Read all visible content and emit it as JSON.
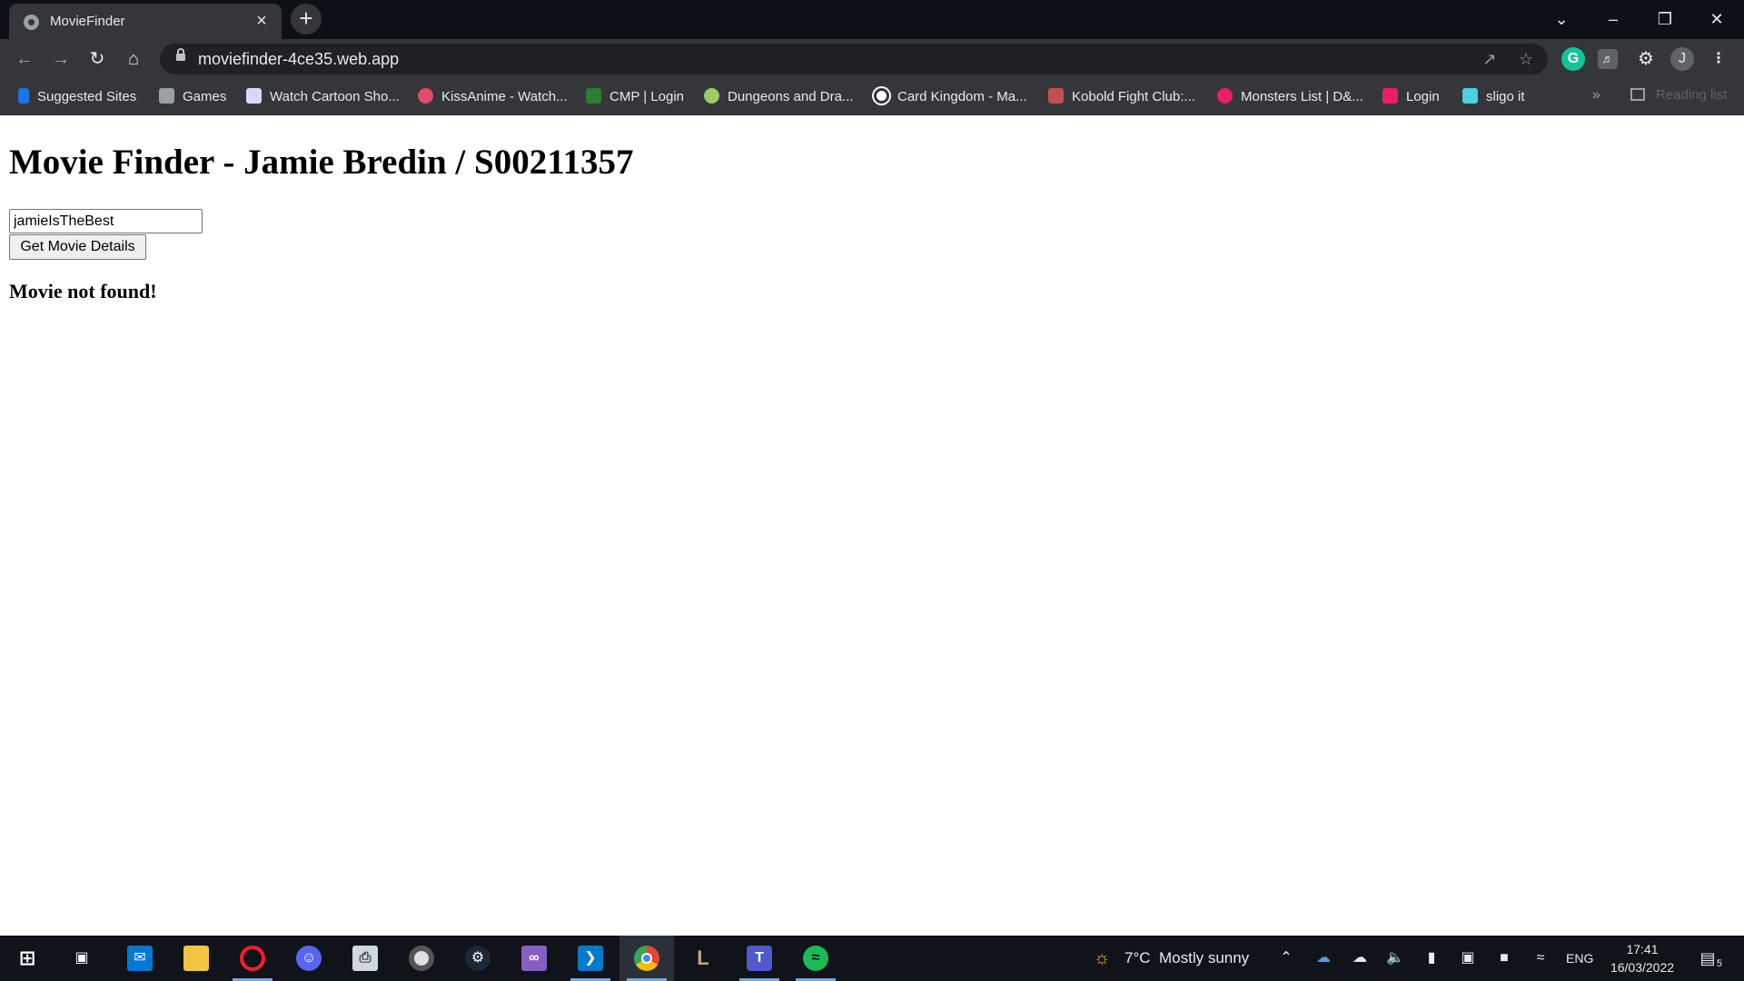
{
  "browser": {
    "tab_title": "MovieFinder",
    "tab_close": "×",
    "new_tab": "+",
    "url": "moviefinder-4ce35.web.app",
    "profile_initial": "J",
    "grammarly_initial": "G"
  },
  "bookmarks": [
    {
      "label": "Suggested Sites",
      "icon": "bing-icon",
      "color": "#1a73e8"
    },
    {
      "label": "Games",
      "icon": "folder-icon",
      "color": "#9aa0a6"
    },
    {
      "label": "Watch Cartoon Sho...",
      "icon": "cartoon-icon",
      "color": "#d6d9ff"
    },
    {
      "label": "KissAnime - Watch...",
      "icon": "kissanime-icon",
      "color": "#e24a6a"
    },
    {
      "label": "CMP | Login",
      "icon": "cmp-icon",
      "color": "#2e7d32"
    },
    {
      "label": "Dungeons and Dra...",
      "icon": "dnd-icon",
      "color": "#9ccc65"
    },
    {
      "label": "Card Kingdom - Ma...",
      "icon": "card-kingdom-icon",
      "color": "#ffffff"
    },
    {
      "label": "Kobold Fight Club:...",
      "icon": "kobold-icon",
      "color": "#c0504d"
    },
    {
      "label": "Monsters List | D&...",
      "icon": "monsters-icon",
      "color": "#e91e63"
    },
    {
      "label": "Login",
      "icon": "login-s-icon",
      "color": "#e91e63"
    },
    {
      "label": "sligo it",
      "icon": "sligo-icon",
      "color": "#4dd0e1"
    }
  ],
  "reading_list": "Reading list",
  "page": {
    "heading": "Movie Finder - Jamie Bredin / S00211357",
    "input_value": "jamieIsTheBest",
    "button_label": "Get Movie Details",
    "result_text": "Movie not found!"
  },
  "taskbar": {
    "weather_temp": "7°C",
    "weather_desc": "Mostly sunny",
    "language": "ENG",
    "time": "17:41",
    "date": "16/03/2022",
    "notification_count": "5"
  }
}
